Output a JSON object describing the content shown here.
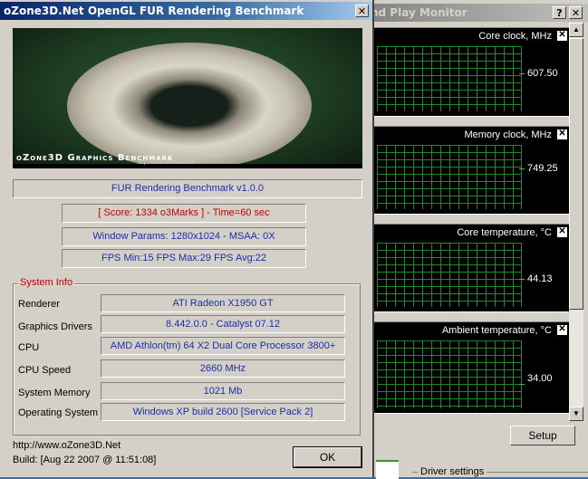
{
  "monitor_window": {
    "title": "nd Play Monitor",
    "help_label": "?",
    "close_label": "✕",
    "graphs": [
      {
        "title": "Core clock, MHz",
        "value": "607.50"
      },
      {
        "title": "Memory clock, MHz",
        "value": "749.25"
      },
      {
        "title": "Core temperature, °C",
        "value": "44.13"
      },
      {
        "title": "Ambient temperature, °C",
        "value": "34.00"
      }
    ],
    "graph_close_label": "✕",
    "setup_label": "Setup",
    "driver_settings_label": "Driver settings"
  },
  "dialog": {
    "title": "oZone3D.Net OpenGL FUR Rendering Benchmark",
    "close_label": "✕",
    "banner_brand": "oZone3D Graphics Benchmark",
    "banner_url": "http://www.ozone3d.net",
    "header": "FUR Rendering Benchmark v1.0.0",
    "score": "[ Score: 1334 o3Marks ] - Time=60 sec",
    "window_params": "Window Params: 1280x1024 - MSAA: 0X",
    "fps": "FPS Min:15   FPS Max:29   FPS Avg:22",
    "system_info_title": "System Info",
    "system_info": [
      {
        "label": "Renderer",
        "value": "ATI Radeon X1950 GT"
      },
      {
        "label": "Graphics Drivers",
        "value": "8.442.0.0 - Catalyst 07.12"
      },
      {
        "label": "CPU",
        "value": "AMD Athlon(tm) 64 X2 Dual Core Processor 3800+"
      },
      {
        "label": "CPU Speed",
        "value": "2660 MHz"
      },
      {
        "label": "System Memory",
        "value": "1021 Mb"
      },
      {
        "label": "Operating System",
        "value": "Windows XP build 2600 [Service Pack 2]"
      }
    ],
    "footer_url": "http://www.oZone3D.Net",
    "footer_build": "Build: [Aug 22 2007 @ 11:51:08]",
    "ok_label": "OK"
  },
  "colors": {
    "value_text": "#1a2fa8",
    "score_text": "#c00000",
    "graph_grid": "#1e8a2c"
  }
}
